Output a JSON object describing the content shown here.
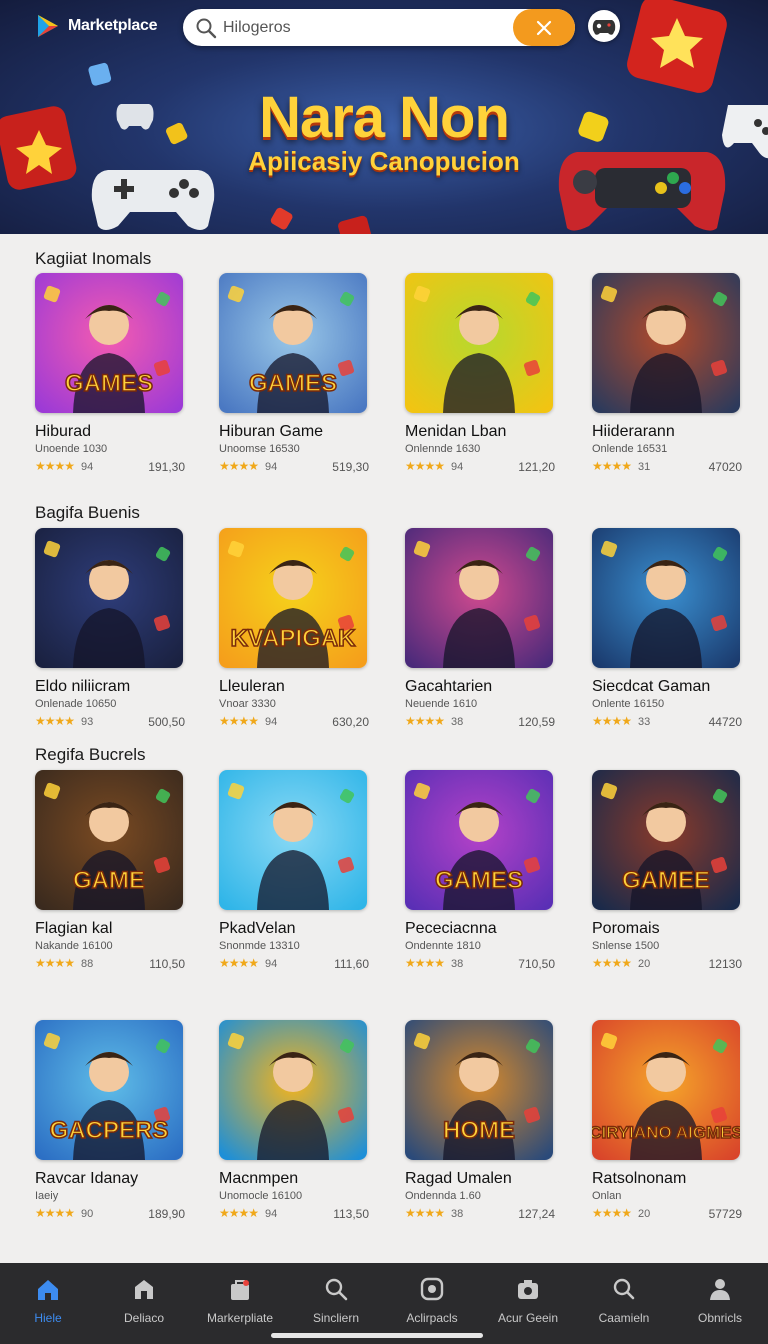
{
  "app": {
    "name": "Marketplace"
  },
  "search": {
    "placeholder": "Hilogeros",
    "clear_icon": "close-icon"
  },
  "banner": {
    "title": "Nara Non",
    "subtitle": "Apiicasiy Canopucion"
  },
  "colors": {
    "accent": "#f39a1e",
    "title_gold": "#ffd23a",
    "nav_bg": "#2b2b2d",
    "nav_active": "#3d8cf0",
    "stars": "#f0a81a"
  },
  "sections": [
    {
      "title": "Kagiiat Inomals",
      "apps": [
        {
          "name": "Hiburad",
          "sub": "Unoende 1030",
          "stars": "★★★★",
          "meta": "94",
          "num": "191,30",
          "art": "GAMES",
          "palette": [
            "#9c3ad6",
            "#f55bb0"
          ]
        },
        {
          "name": "Hiburan Game",
          "sub": "Unoomse 16530",
          "stars": "★★★★",
          "meta": "94",
          "num": "519,30",
          "art": "GAMES",
          "palette": [
            "#4a78c2",
            "#9ac8e8"
          ]
        },
        {
          "name": "Menidan Lban",
          "sub": "Onlennde 1630",
          "stars": "★★★★",
          "meta": "94",
          "num": "121,20",
          "art": "",
          "palette": [
            "#f2c412",
            "#b6d92e"
          ]
        },
        {
          "name": "Hiiderarann",
          "sub": "Onlende 16531",
          "stars": "★★★★",
          "meta": "31",
          "num": "47020",
          "art": "",
          "palette": [
            "#2b3a5c",
            "#b34a2a"
          ]
        }
      ]
    },
    {
      "title": "Bagifa Buenis",
      "apps": [
        {
          "name": "Eldo niliicram",
          "sub": "Onlenade 10650",
          "stars": "★★★★",
          "meta": "93",
          "num": "500,50",
          "art": "",
          "palette": [
            "#1a2140",
            "#2e3d7a"
          ]
        },
        {
          "name": "Lleuleran",
          "sub": "Vnoar 3330",
          "stars": "★★★★",
          "meta": "94",
          "num": "630,20",
          "art": "KVAPIGAK",
          "palette": [
            "#f59e1b",
            "#f5d21b"
          ]
        },
        {
          "name": "Gacahtarien",
          "sub": "Neuende 1610",
          "stars": "★★★★",
          "meta": "38",
          "num": "120,59",
          "art": "",
          "palette": [
            "#4a2a7a",
            "#d14a8f"
          ]
        },
        {
          "name": "Siecdcat Gaman",
          "sub": "Onlente 16150",
          "stars": "★★★★",
          "meta": "33",
          "num": "44720",
          "art": "",
          "palette": [
            "#1b3b6e",
            "#3a8fd0"
          ]
        }
      ]
    },
    {
      "title": "Regifa Bucrels",
      "apps": [
        {
          "name": "Flagian kal",
          "sub": "Nakande 16100",
          "stars": "★★★★",
          "meta": "88",
          "num": "110,50",
          "art": "GAME",
          "palette": [
            "#3a2a1e",
            "#7a4a22"
          ]
        },
        {
          "name": "PkadVelan",
          "sub": "Snonmde 13310",
          "stars": "★★★★",
          "meta": "94",
          "num": "111,60",
          "art": "",
          "palette": [
            "#2fb5e8",
            "#8ad9f5"
          ]
        },
        {
          "name": "Pececiacnna",
          "sub": "Ondennte 1810",
          "stars": "★★★★",
          "meta": "38",
          "num": "710,50",
          "art": "GAMES",
          "palette": [
            "#5a2fb5",
            "#b542c8"
          ]
        },
        {
          "name": "Poromais",
          "sub": "Snlense 1500",
          "stars": "★★★★",
          "meta": "20",
          "num": "12130",
          "art": "GAMEE",
          "palette": [
            "#1a2a4a",
            "#8a3a2a"
          ]
        }
      ]
    },
    {
      "title": "",
      "apps": [
        {
          "name": "Ravcar Idanay",
          "sub": "Iaeiy",
          "stars": "★★★★",
          "meta": "90",
          "num": "189,90",
          "art": "GACPERS",
          "palette": [
            "#2c6fc4",
            "#5fbde8"
          ]
        },
        {
          "name": "Macnmpen",
          "sub": "Unomocle 16100",
          "stars": "★★★★",
          "meta": "94",
          "num": "113,50",
          "art": "",
          "palette": [
            "#1d8fd8",
            "#f5b41b"
          ]
        },
        {
          "name": "Ragad Umalen",
          "sub": "Ondennda 1.60",
          "stars": "★★★★",
          "meta": "38",
          "num": "127,24",
          "art": "HOME",
          "palette": [
            "#2a4a7a",
            "#d98a2a"
          ]
        },
        {
          "name": "Ratsolnonam",
          "sub": "Onlan",
          "stars": "★★★★",
          "meta": "20",
          "num": "57729",
          "art": "CIRYIANO AIGMES",
          "palette": [
            "#d9452a",
            "#f5a52a"
          ]
        }
      ]
    }
  ],
  "nav": [
    {
      "label": "Hiele",
      "icon": "home-icon",
      "active": true
    },
    {
      "label": "Deliaco",
      "icon": "store-icon",
      "active": false
    },
    {
      "label": "Markerpliate",
      "icon": "bag-icon",
      "active": false
    },
    {
      "label": "Sincliern",
      "icon": "search-icon",
      "active": false
    },
    {
      "label": "Aclirpacls",
      "icon": "apps-icon",
      "active": false
    },
    {
      "label": "Acur Geein",
      "icon": "camera-icon",
      "active": false
    },
    {
      "label": "Caamieln",
      "icon": "discover-icon",
      "active": false
    },
    {
      "label": "Obnricls",
      "icon": "profile-icon",
      "active": false
    }
  ]
}
